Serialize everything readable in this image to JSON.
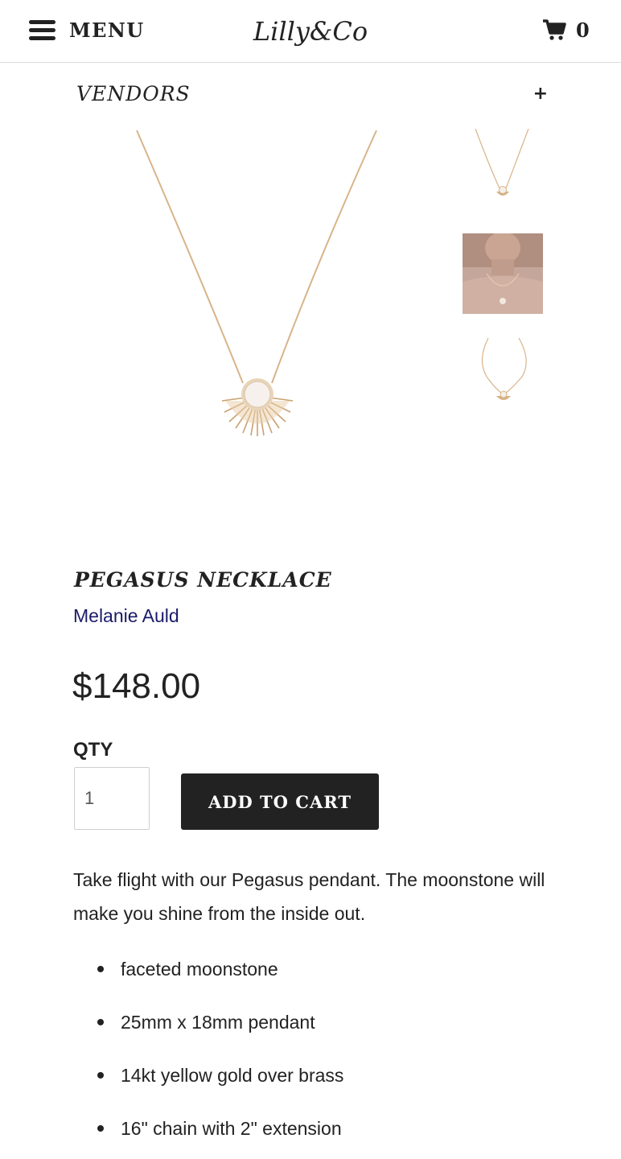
{
  "header": {
    "menu_label": "MENU",
    "logo_text": "Lilly&Co",
    "cart_count": "0"
  },
  "vendors": {
    "label": "VENDORS",
    "toggle": "+"
  },
  "product": {
    "title": "PEGASUS NECKLACE",
    "vendor": "Melanie Auld",
    "price": "$148.00",
    "qty_label": "QTY",
    "qty_value": "1",
    "add_to_cart": "ADD TO CART",
    "description": "Take flight with our Pegasus pendant. The moonstone will make you shine from the inside out.",
    "features": [
      "faceted moonstone",
      "25mm x 18mm pendant",
      "14kt yellow gold over brass",
      "16\" chain with 2\" extension"
    ]
  },
  "icons": {
    "menu": "hamburger-icon",
    "cart": "shopping-cart-icon",
    "expand": "plus-icon"
  },
  "colors": {
    "text": "#222222",
    "link": "#1b1b6b",
    "button_bg": "#222222",
    "button_text": "#ffffff",
    "gold": "#d8b48a"
  }
}
